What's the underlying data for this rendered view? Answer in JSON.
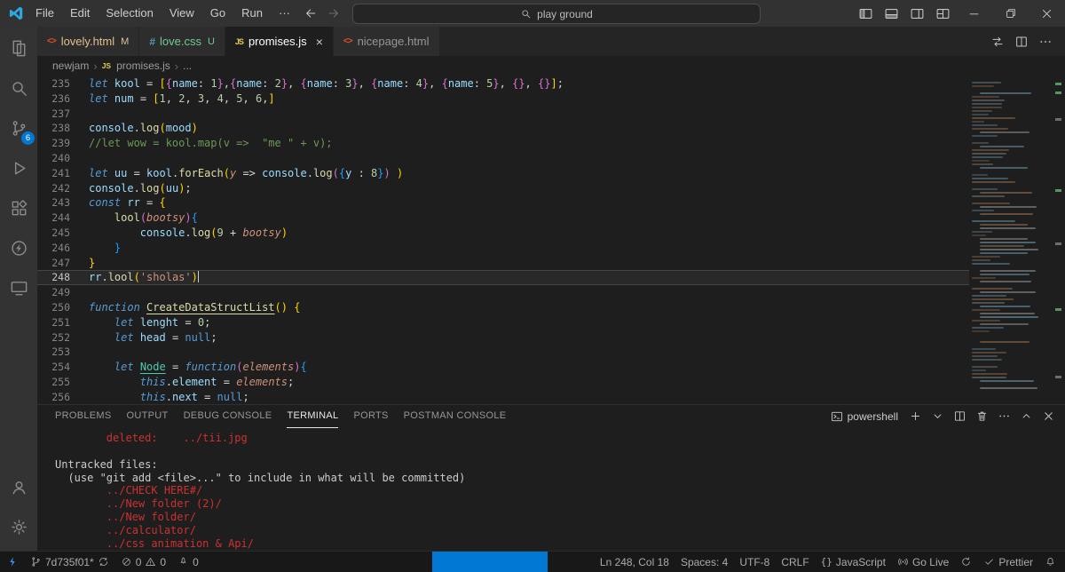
{
  "title_bar": {
    "menus": [
      "File",
      "Edit",
      "Selection",
      "View",
      "Go",
      "Run"
    ],
    "overflow_menu": "···",
    "search_text": "play ground"
  },
  "tabs": [
    {
      "label": "lovely.html",
      "icon": "html",
      "badge": "M",
      "label_color": "#e2c08d",
      "badge_color": "#e2c08d",
      "active": false
    },
    {
      "label": "love.css",
      "icon": "css",
      "badge": "U",
      "label_color": "#73c991",
      "badge_color": "#73c991",
      "active": false
    },
    {
      "label": "promises.js",
      "icon": "js",
      "badge": "",
      "label_color": "#ffffff",
      "badge_color": "",
      "active": true,
      "close": "×"
    },
    {
      "label": "nicepage.html",
      "icon": "html",
      "badge": "",
      "label_color": "#969696",
      "badge_color": "",
      "active": false
    }
  ],
  "breadcrumb": {
    "items": [
      "newjam",
      "promises.js",
      "..."
    ]
  },
  "activity_bar": {
    "top": [
      {
        "icon": "explorer"
      },
      {
        "icon": "search"
      },
      {
        "icon": "source-control",
        "badge": "6"
      },
      {
        "icon": "run-debug"
      },
      {
        "icon": "extensions"
      },
      {
        "icon": "thunder-client"
      },
      {
        "icon": "remote-explorer"
      }
    ],
    "bottom": [
      {
        "icon": "account"
      },
      {
        "icon": "settings"
      }
    ]
  },
  "editor": {
    "current_line": 248,
    "lines": [
      {
        "n": 235,
        "t": [
          [
            "kw",
            "let "
          ],
          [
            "var",
            "kool"
          ],
          [
            "op",
            " = "
          ],
          [
            "p1",
            "["
          ],
          [
            "p2",
            "{"
          ],
          [
            "pr",
            "name"
          ],
          [
            "op",
            ": "
          ],
          [
            "num",
            "1"
          ],
          [
            "p2",
            "}"
          ],
          [
            "op",
            ","
          ],
          [
            "p2",
            "{"
          ],
          [
            "pr",
            "name"
          ],
          [
            "op",
            ": "
          ],
          [
            "num",
            "2"
          ],
          [
            "p2",
            "}"
          ],
          [
            "op",
            ", "
          ],
          [
            "p2",
            "{"
          ],
          [
            "pr",
            "name"
          ],
          [
            "op",
            ": "
          ],
          [
            "num",
            "3"
          ],
          [
            "p2",
            "}"
          ],
          [
            "op",
            ", "
          ],
          [
            "p2",
            "{"
          ],
          [
            "pr",
            "name"
          ],
          [
            "op",
            ": "
          ],
          [
            "num",
            "4"
          ],
          [
            "p2",
            "}"
          ],
          [
            "op",
            ", "
          ],
          [
            "p2",
            "{"
          ],
          [
            "pr",
            "name"
          ],
          [
            "op",
            ": "
          ],
          [
            "num",
            "5"
          ],
          [
            "p2",
            "}"
          ],
          [
            "op",
            ", "
          ],
          [
            "p2",
            "{}"
          ],
          [
            "op",
            ", "
          ],
          [
            "p2",
            "{}"
          ],
          [
            "p1",
            "]"
          ],
          [
            "op",
            ";"
          ]
        ]
      },
      {
        "n": 236,
        "t": [
          [
            "kw",
            "let "
          ],
          [
            "var",
            "num"
          ],
          [
            "op",
            " = "
          ],
          [
            "p1",
            "["
          ],
          [
            "num",
            "1"
          ],
          [
            "op",
            ", "
          ],
          [
            "num",
            "2"
          ],
          [
            "op",
            ", "
          ],
          [
            "num",
            "3"
          ],
          [
            "op",
            ", "
          ],
          [
            "num",
            "4"
          ],
          [
            "op",
            ", "
          ],
          [
            "num",
            "5"
          ],
          [
            "op",
            ", "
          ],
          [
            "num",
            "6"
          ],
          [
            "op",
            ","
          ],
          [
            "p1",
            "]"
          ]
        ]
      },
      {
        "n": 237,
        "t": []
      },
      {
        "n": 238,
        "t": [
          [
            "var",
            "console"
          ],
          [
            "op",
            "."
          ],
          [
            "fn",
            "log"
          ],
          [
            "p1",
            "("
          ],
          [
            "var",
            "mood"
          ],
          [
            "p1",
            ")"
          ]
        ]
      },
      {
        "n": 239,
        "t": [
          [
            "com",
            "//let wow = kool.map(v =>  \"me \" + v);"
          ]
        ]
      },
      {
        "n": 240,
        "t": []
      },
      {
        "n": 241,
        "t": [
          [
            "kw",
            "let "
          ],
          [
            "var",
            "uu"
          ],
          [
            "op",
            " = "
          ],
          [
            "var",
            "kool"
          ],
          [
            "op",
            "."
          ],
          [
            "fn",
            "forEach"
          ],
          [
            "p1",
            "("
          ],
          [
            "pa",
            "y"
          ],
          [
            "op",
            " => "
          ],
          [
            "var",
            "console"
          ],
          [
            "op",
            "."
          ],
          [
            "fn",
            "log"
          ],
          [
            "p2",
            "("
          ],
          [
            "p3",
            "{"
          ],
          [
            "var",
            "y"
          ],
          [
            "op",
            " : "
          ],
          [
            "num",
            "8"
          ],
          [
            "p3",
            "}"
          ],
          [
            "p2",
            ")"
          ],
          [
            "op",
            " "
          ],
          [
            "p1",
            ")"
          ]
        ]
      },
      {
        "n": 242,
        "t": [
          [
            "var",
            "console"
          ],
          [
            "op",
            "."
          ],
          [
            "fn",
            "log"
          ],
          [
            "p1",
            "("
          ],
          [
            "var",
            "uu"
          ],
          [
            "p1",
            ")"
          ],
          [
            "op",
            ";"
          ]
        ]
      },
      {
        "n": 243,
        "t": [
          [
            "kw",
            "const "
          ],
          [
            "var",
            "rr"
          ],
          [
            "op",
            " = "
          ],
          [
            "p1",
            "{"
          ]
        ]
      },
      {
        "n": 244,
        "t": [
          [
            "ws",
            "    "
          ],
          [
            "fn",
            "lool"
          ],
          [
            "p2",
            "("
          ],
          [
            "pa",
            "bootsy"
          ],
          [
            "p2",
            ")"
          ],
          [
            "p3",
            "{"
          ]
        ]
      },
      {
        "n": 245,
        "t": [
          [
            "ws",
            "        "
          ],
          [
            "var",
            "console"
          ],
          [
            "op",
            "."
          ],
          [
            "fn",
            "log"
          ],
          [
            "p1",
            "("
          ],
          [
            "num",
            "9"
          ],
          [
            "op",
            " + "
          ],
          [
            "pa",
            "bootsy"
          ],
          [
            "p1",
            ")"
          ]
        ]
      },
      {
        "n": 246,
        "t": [
          [
            "ws",
            "    "
          ],
          [
            "p3",
            "}"
          ]
        ]
      },
      {
        "n": 247,
        "t": [
          [
            "p1",
            "}"
          ]
        ]
      },
      {
        "n": 248,
        "caret": true,
        "t": [
          [
            "var",
            "rr"
          ],
          [
            "op",
            "."
          ],
          [
            "fn",
            "lool"
          ],
          [
            "p1",
            "("
          ],
          [
            "str",
            "'sholas'"
          ],
          [
            "p1",
            ")"
          ]
        ]
      },
      {
        "n": 249,
        "t": []
      },
      {
        "n": 250,
        "t": [
          [
            "kw",
            "function "
          ],
          [
            "fnu",
            "CreateDataStructList"
          ],
          [
            "p1",
            "()"
          ],
          [
            "op",
            " "
          ],
          [
            "p1",
            "{"
          ]
        ]
      },
      {
        "n": 251,
        "t": [
          [
            "ws",
            "    "
          ],
          [
            "kw",
            "let "
          ],
          [
            "var",
            "lenght"
          ],
          [
            "op",
            " = "
          ],
          [
            "num",
            "0"
          ],
          [
            "op",
            ";"
          ]
        ]
      },
      {
        "n": 252,
        "t": [
          [
            "ws",
            "    "
          ],
          [
            "kw",
            "let "
          ],
          [
            "var",
            "head"
          ],
          [
            "op",
            " = "
          ],
          [
            "kb",
            "null"
          ],
          [
            "op",
            ";"
          ]
        ]
      },
      {
        "n": 253,
        "t": []
      },
      {
        "n": 254,
        "t": [
          [
            "ws",
            "    "
          ],
          [
            "kw",
            "let "
          ],
          [
            "vu",
            "Node"
          ],
          [
            "op",
            " = "
          ],
          [
            "kw",
            "function"
          ],
          [
            "p2",
            "("
          ],
          [
            "pa",
            "elements"
          ],
          [
            "p2",
            ")"
          ],
          [
            "p3",
            "{"
          ]
        ]
      },
      {
        "n": 255,
        "t": [
          [
            "ws",
            "        "
          ],
          [
            "kw",
            "this"
          ],
          [
            "op",
            "."
          ],
          [
            "var",
            "element"
          ],
          [
            "op",
            " = "
          ],
          [
            "pa",
            "elements"
          ],
          [
            "op",
            ";"
          ]
        ]
      },
      {
        "n": 256,
        "t": [
          [
            "ws",
            "        "
          ],
          [
            "kw",
            "this"
          ],
          [
            "op",
            "."
          ],
          [
            "var",
            "next"
          ],
          [
            "op",
            " = "
          ],
          [
            "kb",
            "null"
          ],
          [
            "op",
            ";"
          ]
        ]
      }
    ]
  },
  "panel": {
    "tabs": [
      "PROBLEMS",
      "OUTPUT",
      "DEBUG CONSOLE",
      "TERMINAL",
      "PORTS",
      "POSTMAN CONSOLE"
    ],
    "active_tab": "TERMINAL",
    "shell_label": "powershell",
    "terminal_lines": [
      {
        "color": "red",
        "text": "        deleted:    ../tii.jpg"
      },
      {
        "color": "plain",
        "text": ""
      },
      {
        "color": "plain",
        "text": "Untracked files:"
      },
      {
        "color": "plain",
        "text": "  (use \"git add <file>...\" to include in what will be committed)"
      },
      {
        "color": "red",
        "text": "        ../CHECK HERE#/"
      },
      {
        "color": "red",
        "text": "        ../New folder (2)/"
      },
      {
        "color": "red",
        "text": "        ../New folder/"
      },
      {
        "color": "red",
        "text": "        ../calculator/"
      },
      {
        "color": "red",
        "text": "        ../css animation & Api/"
      }
    ]
  },
  "status_bar": {
    "branch": "7d735f01*",
    "errors": "0",
    "warnings": "0",
    "rocket_count": "0",
    "line_col": "Ln 248, Col 18",
    "indentation": "Spaces: 4",
    "encoding": "UTF-8",
    "eol": "CRLF",
    "language_icon": "{}",
    "language": "JavaScript",
    "go_live": "Go Live",
    "formatter": "Prettier"
  },
  "colors": {
    "accent": "#0078d4",
    "terminal_red": "#cd3131",
    "modified_badge": "#e2c08d",
    "untracked_badge": "#73c991"
  }
}
